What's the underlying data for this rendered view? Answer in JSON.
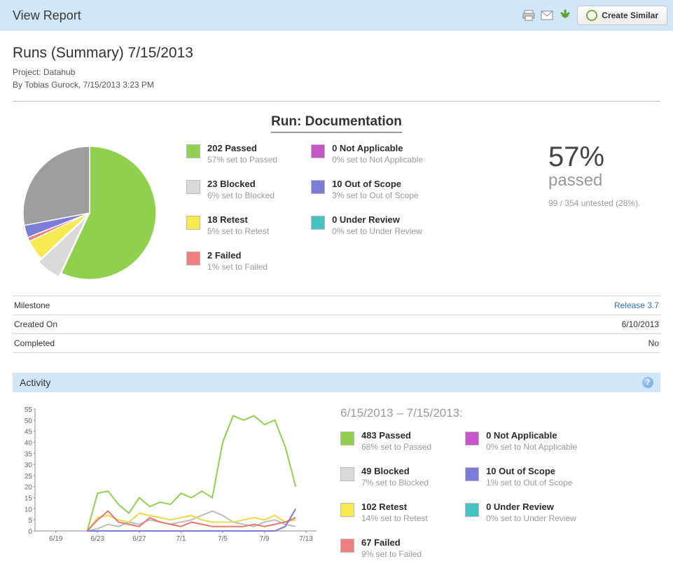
{
  "header": {
    "title": "View Report",
    "create_similar": "Create Similar"
  },
  "report": {
    "summary_title": "Runs (Summary) 7/15/2013",
    "project_line": "Project: Datahub",
    "byline": "By Tobias Gurock, 7/15/2013 3:23 PM",
    "run_title": "Run: Documentation"
  },
  "chart_data": [
    {
      "type": "pie",
      "title": "Run: Documentation",
      "series": [
        {
          "name": "Passed",
          "value": 202,
          "pct": 57,
          "color": "#8fd14f"
        },
        {
          "name": "Blocked",
          "value": 23,
          "pct": 6,
          "color": "#d9d9d9"
        },
        {
          "name": "Retest",
          "value": 18,
          "pct": 5,
          "color": "#f6ea4e"
        },
        {
          "name": "Failed",
          "value": 2,
          "pct": 1,
          "color": "#f17f7f"
        },
        {
          "name": "Not Applicable",
          "value": 0,
          "pct": 0,
          "color": "#c657c6"
        },
        {
          "name": "Out of Scope",
          "value": 10,
          "pct": 3,
          "color": "#7c7cd8"
        },
        {
          "name": "Under Review",
          "value": 0,
          "pct": 0,
          "color": "#44c1c1"
        }
      ],
      "untested": {
        "count": 99,
        "total": 354,
        "pct": 28,
        "color": "#9a9a9a"
      }
    },
    {
      "type": "line",
      "title": "6/15/2013 – 7/15/2013",
      "xlabel": "",
      "ylabel": "",
      "ylim": [
        0,
        55
      ],
      "yticks": [
        0,
        5,
        10,
        15,
        20,
        25,
        30,
        35,
        40,
        45,
        50,
        55
      ],
      "categories": [
        "6/19",
        "6/23",
        "6/27",
        "7/1",
        "7/5",
        "7/9",
        "7/13"
      ],
      "x": [
        0,
        1,
        2,
        3,
        4,
        5,
        6,
        7,
        8,
        9,
        10,
        11,
        12,
        13,
        14,
        15,
        16,
        17,
        18,
        19,
        20,
        21,
        22,
        23,
        24,
        25,
        26,
        27
      ],
      "series": [
        {
          "name": "Passed",
          "color": "#8fd14f",
          "values": [
            null,
            null,
            null,
            null,
            null,
            0,
            17,
            18,
            12,
            8,
            15,
            11,
            13,
            12,
            17,
            15,
            18,
            15,
            40,
            52,
            50,
            52,
            48,
            50,
            38,
            20,
            null,
            null
          ]
        },
        {
          "name": "Blocked",
          "color": "#bcbcbc",
          "values": [
            null,
            null,
            null,
            null,
            null,
            0,
            1,
            3,
            2,
            4,
            3,
            5,
            4,
            3,
            4,
            5,
            7,
            9,
            7,
            4,
            3,
            2,
            4,
            5,
            3,
            2,
            null,
            null
          ]
        },
        {
          "name": "Retest",
          "color": "#e8d84a",
          "values": [
            null,
            null,
            null,
            null,
            null,
            0,
            6,
            7,
            5,
            4,
            8,
            7,
            6,
            5,
            6,
            7,
            5,
            4,
            4,
            4,
            5,
            6,
            5,
            7,
            4,
            5,
            null,
            null
          ]
        },
        {
          "name": "Failed",
          "color": "#e57676",
          "values": [
            null,
            null,
            null,
            null,
            null,
            0,
            5,
            9,
            4,
            3,
            2,
            6,
            4,
            3,
            2,
            4,
            3,
            2,
            2,
            2,
            2,
            3,
            2,
            3,
            4,
            6,
            null,
            null
          ]
        },
        {
          "name": "Out of Scope",
          "color": "#7c7cd8",
          "values": [
            null,
            null,
            null,
            null,
            null,
            0,
            0,
            0,
            0,
            0,
            0,
            0,
            0,
            0,
            0,
            0,
            0,
            0,
            0,
            0,
            0,
            0,
            0,
            0,
            2,
            10,
            null,
            null
          ]
        }
      ]
    }
  ],
  "legend_left": [
    {
      "title": "202 Passed",
      "sub": "57% set to Passed",
      "color": "#8fd14f"
    },
    {
      "title": "23 Blocked",
      "sub": "6% set to Blocked",
      "color": "#d9d9d9"
    },
    {
      "title": "18 Retest",
      "sub": "5% set to Retest",
      "color": "#f6ea4e"
    },
    {
      "title": "2 Failed",
      "sub": "1% set to Failed",
      "color": "#f17f7f"
    }
  ],
  "legend_right": [
    {
      "title": "0 Not Applicable",
      "sub": "0% set to Not Applicable",
      "color": "#c657c6"
    },
    {
      "title": "10 Out of Scope",
      "sub": "3% set to Out of Scope",
      "color": "#7c7cd8"
    },
    {
      "title": "0 Under Review",
      "sub": "0% set to Under Review",
      "color": "#44c1c1"
    }
  ],
  "big_pct": {
    "pct": "57%",
    "label": "passed",
    "untested": "99 / 354 untested (28%)."
  },
  "info_rows": [
    {
      "label": "Milestone",
      "value": "Release 3.7",
      "link": true
    },
    {
      "label": "Created On",
      "value": "6/10/2013",
      "link": false
    },
    {
      "label": "Completed",
      "value": "No",
      "link": false
    }
  ],
  "activity": {
    "header": "Activity",
    "range": "6/15/2013 – 7/15/2013:",
    "legend_left": [
      {
        "title": "483 Passed",
        "sub": "68% set to Passed",
        "color": "#8fd14f"
      },
      {
        "title": "49 Blocked",
        "sub": "7% set to Blocked",
        "color": "#d9d9d9"
      },
      {
        "title": "102 Retest",
        "sub": "14% set to Retest",
        "color": "#f6ea4e"
      },
      {
        "title": "67 Failed",
        "sub": "9% set to Failed",
        "color": "#f17f7f"
      }
    ],
    "legend_right": [
      {
        "title": "0 Not Applicable",
        "sub": "0% set to Not Applicable",
        "color": "#c657c6"
      },
      {
        "title": "10 Out of Scope",
        "sub": "1% set to Out of Scope",
        "color": "#7c7cd8"
      },
      {
        "title": "0 Under Review",
        "sub": "0% set to Under Review",
        "color": "#44c1c1"
      }
    ]
  }
}
